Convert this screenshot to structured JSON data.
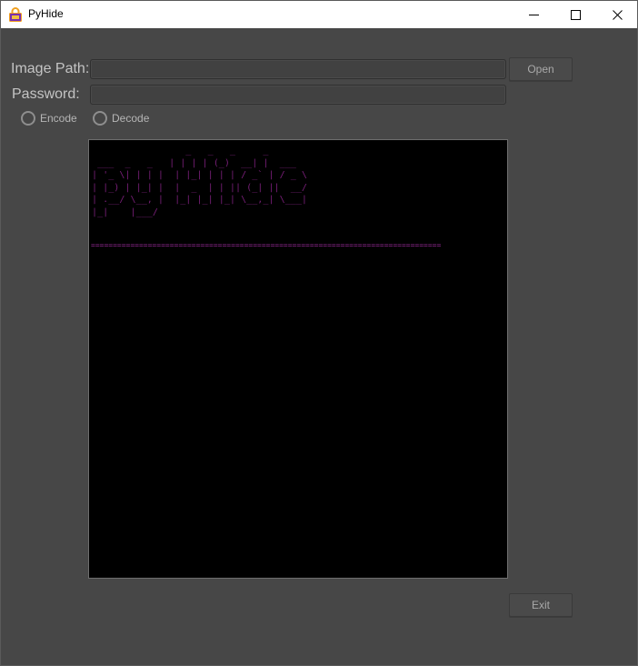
{
  "window": {
    "title": "PyHide"
  },
  "form": {
    "image_path_label": "Image Path:",
    "image_path_value": "",
    "password_label": "Password:",
    "password_value": "",
    "open_label": "Open",
    "encode_label": "Encode",
    "decode_label": "Decode",
    "exit_label": "Exit"
  },
  "console": {
    "banner": "                 _   _   _     _\n ___  _   _   | | | | (_)  __| |  ___\n| '_ \\| | | |  | |_| | | | / _` | / _ \\\n| |_) | |_| |  |  _  | | || (_| ||  __/\n| .__/ \\__, |  |_| |_| |_| \\__,_| \\___|\n|_|    |___/",
    "separator": "================================================================================"
  },
  "colors": {
    "background": "#474747",
    "console_bg": "#000000",
    "console_text": "#7a1f7a"
  }
}
